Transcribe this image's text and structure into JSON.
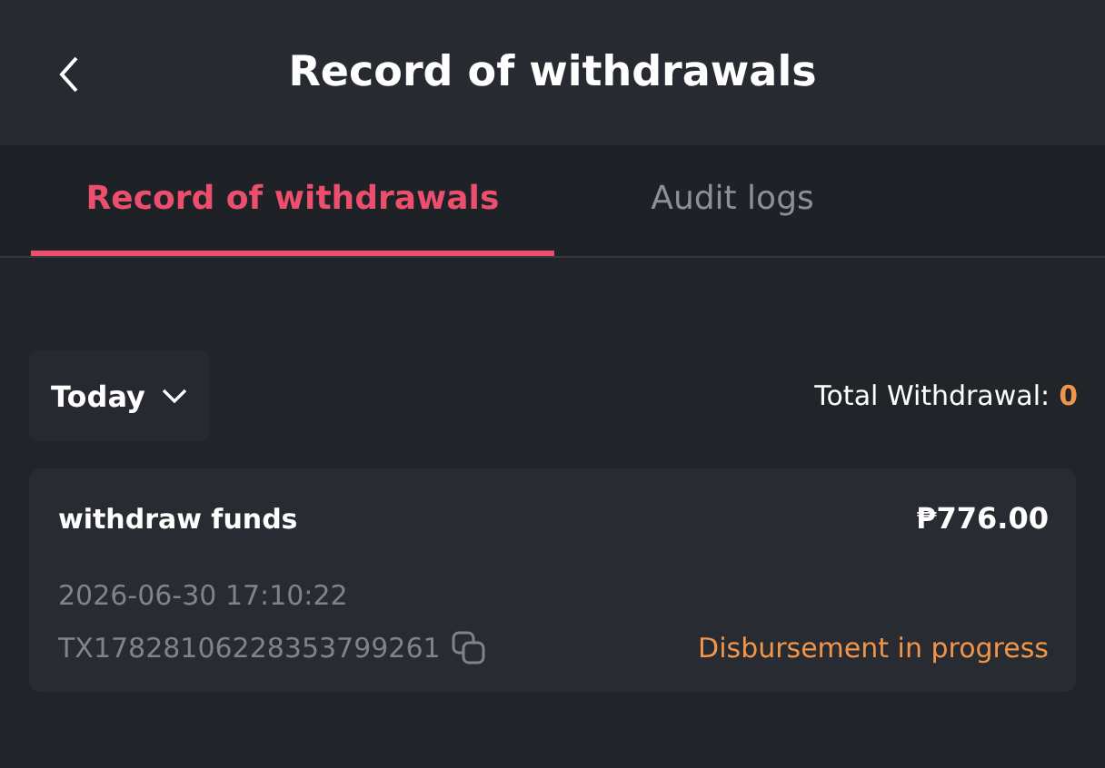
{
  "header": {
    "title": "Record of withdrawals"
  },
  "tabs": [
    {
      "label": "Record of withdrawals",
      "selected": true
    },
    {
      "label": "Audit logs",
      "selected": false
    }
  ],
  "filter": {
    "label": "Today"
  },
  "total": {
    "label": "Total Withdrawal:",
    "value": "0"
  },
  "records": [
    {
      "title": "withdraw funds",
      "amount": "₱776.00",
      "time": "2026-06-30 17:10:22",
      "tx": "TX17828106228353799261",
      "status": "Disbursement in progress"
    }
  ]
}
